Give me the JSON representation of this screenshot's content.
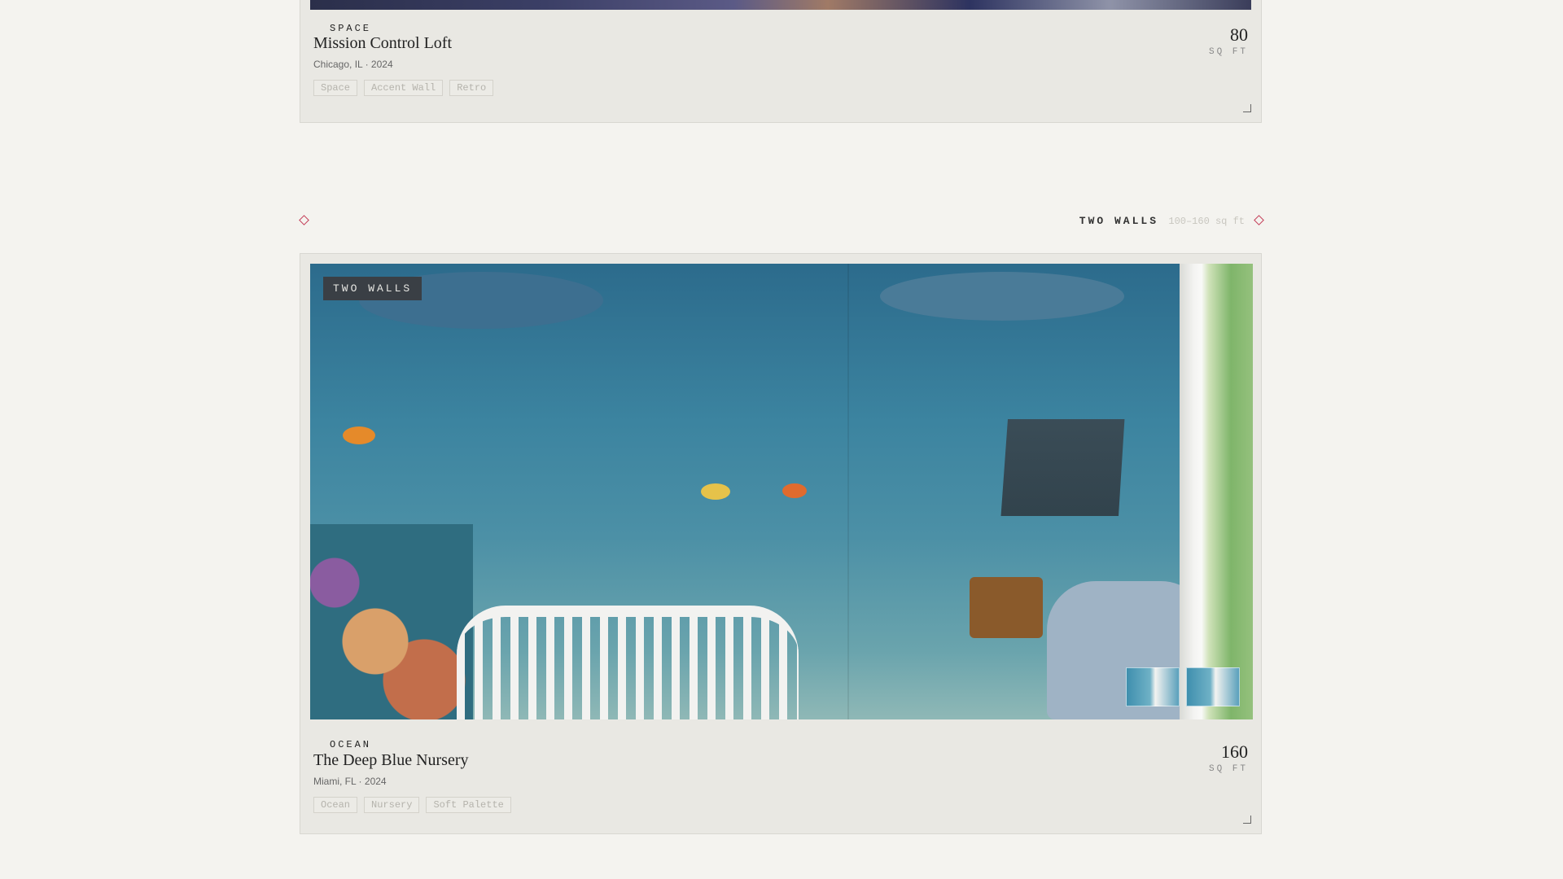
{
  "cards": [
    {
      "category": "SPACE",
      "title": "Mission Control Loft",
      "meta": "Chicago, IL · 2024",
      "tags": [
        "Space",
        "Accent Wall",
        "Retro"
      ],
      "area_value": "80",
      "area_unit": "SQ FT"
    },
    {
      "badge": "TWO WALLS",
      "category": "OCEAN",
      "title": "The Deep Blue Nursery",
      "meta": "Miami, FL · 2024",
      "tags": [
        "Ocean",
        "Nursery",
        "Soft Palette"
      ],
      "area_value": "160",
      "area_unit": "SQ FT"
    }
  ],
  "section": {
    "label": "TWO WALLS",
    "range": "100–160 sq ft"
  },
  "colors": {
    "accent": "#c33c57",
    "page_bg": "#f4f3ef",
    "card_bg": "#e9e8e3",
    "badge_bg": "#3a3f45"
  },
  "icons": {
    "section_marker": "diamond-icon",
    "card_corner": "corner-resize-icon"
  }
}
